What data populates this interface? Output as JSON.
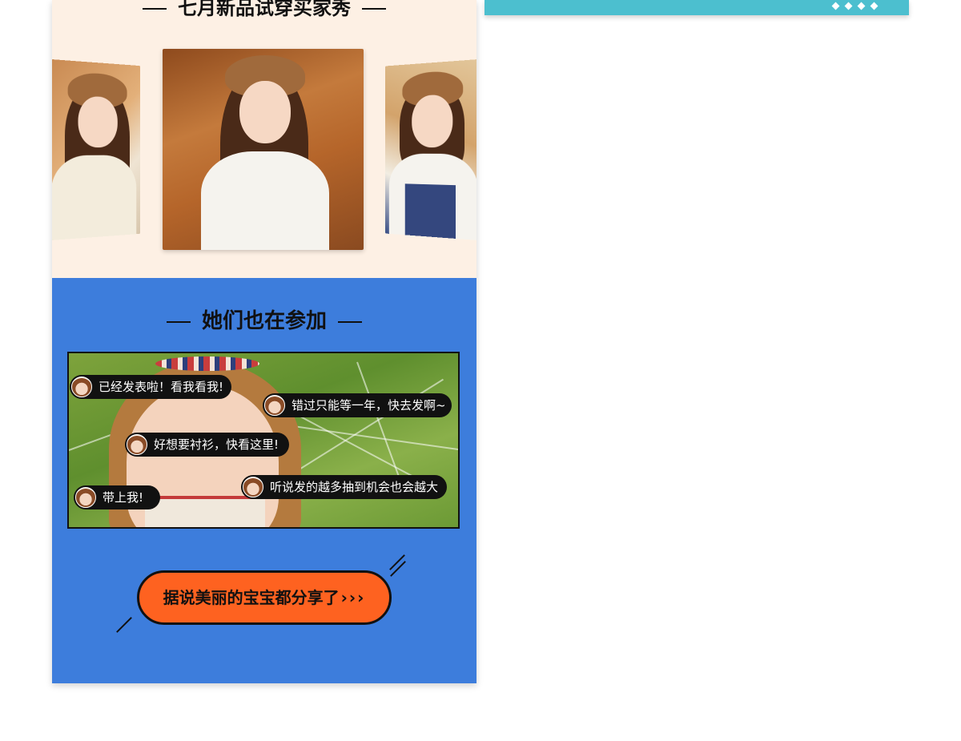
{
  "promo": {
    "top_section": {
      "title": "七月新品试穿买家秀",
      "photos": [
        {
          "name": "left-photo"
        },
        {
          "name": "center-photo"
        },
        {
          "name": "right-photo"
        }
      ]
    },
    "bottom_section": {
      "title": "她们也在参加",
      "comments": [
        {
          "text": "已经发表啦！看我看我!"
        },
        {
          "text": "错过只能等一年，快去发啊~"
        },
        {
          "text": "好想要衬衫，快看这里!"
        },
        {
          "text": "听说发的越多抽到机会也会越大"
        },
        {
          "text": "带上我!"
        }
      ],
      "cta": {
        "label": "据说美丽的宝宝都分享了",
        "arrows": "›››"
      }
    }
  },
  "colors": {
    "cream": "#fdf0e4",
    "blue": "#3d7ddc",
    "orange": "#fe6220",
    "teal": "#4cbfcf",
    "black": "#111111"
  },
  "icons": {
    "decoration": "diamond-icon"
  }
}
